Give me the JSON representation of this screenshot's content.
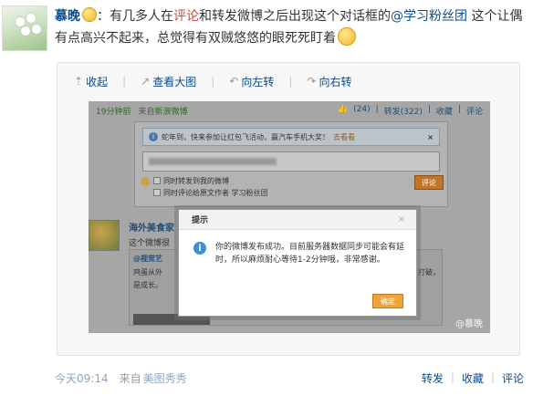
{
  "post": {
    "author": "慕晚",
    "text_1": "：有几多人在",
    "link_comment": "评论",
    "text_2": "和转发微博之后出现这个对话框的",
    "mention": "@学习粉丝团",
    "text_3": " 这个让偶有点高兴不起来，总觉得有双贼悠悠的眼死死盯着"
  },
  "toolbar": {
    "collapse": "收起",
    "view_large": "查看大图",
    "rotate_left": "向左转",
    "rotate_right": "向右转"
  },
  "screenshot": {
    "time": "19分钟前",
    "source_prefix": "来自",
    "source": "新浪微博",
    "likes": "(24)",
    "forward": "转发(322)",
    "favorite": "收藏",
    "comment": "评论",
    "notice": "蛇年到，快来参加让红包飞活动，赢汽车手机大奖！",
    "notice_link": "去看看",
    "check_forward": "同时转发到我的微博",
    "check_comment": "同时评论给原文作者 学习粉丝团",
    "comment_btn": "评论",
    "user_name": "海外美食家",
    "user_line": "这个微博很",
    "quote_name": "@视觉艺",
    "quote_text": "鸡蛋从外",
    "quote_text_2": "是成长。",
    "quote_tail": "打破，"
  },
  "dialog": {
    "title": "提示",
    "close": "×",
    "message": "你的微博发布成功。目前服务器数据同步可能会有延时，所以麻烦耐心等待1-2分钟哦，非常感谢。",
    "ok": "确定"
  },
  "watermark": "@慕晚",
  "footer": {
    "time": "今天09:14",
    "source_prefix": "来自",
    "source": "美图秀秀",
    "forward": "转发",
    "favorite": "收藏",
    "comment": "评论",
    "sep": "|"
  }
}
